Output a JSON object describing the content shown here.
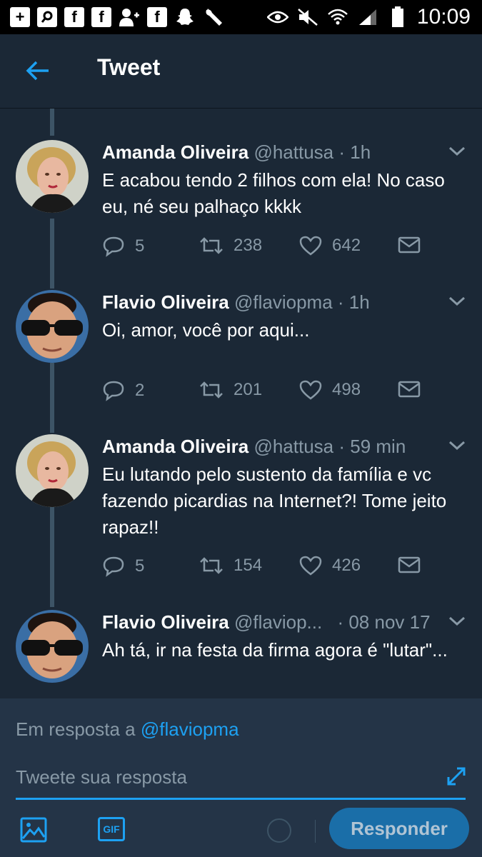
{
  "status_bar": {
    "time": "10:09",
    "left_icons": [
      "add-box-icon",
      "search-box-icon",
      "facebook-icon",
      "facebook-icon",
      "add-friend-icon",
      "facebook-icon",
      "snapchat-icon",
      "wrench-icon"
    ],
    "right_icons": [
      "eye-icon",
      "mute-icon",
      "wifi-icon",
      "signal-icon",
      "battery-icon"
    ]
  },
  "app_bar": {
    "title": "Tweet"
  },
  "tweets": [
    {
      "name": "Amanda Oliveira",
      "handle": "@hattusa",
      "time": "· 1h",
      "text": "E acabou tendo 2 filhos com ela! No caso eu, né seu palhaço kkkk",
      "replies": "5",
      "retweets": "238",
      "likes": "642"
    },
    {
      "name": "Flavio Oliveira",
      "handle": "@flaviopma",
      "time": "· 1h",
      "text": "Oi, amor, você por aqui...",
      "replies": "2",
      "retweets": "201",
      "likes": "498"
    },
    {
      "name": "Amanda Oliveira",
      "handle": "@hattusa",
      "time": "· 59 min",
      "text": "Eu lutando pelo sustento da família e vc fazendo picardias na Internet?! Tome jeito rapaz!!",
      "replies": "5",
      "retweets": "154",
      "likes": "426"
    },
    {
      "name": "Flavio Oliveira",
      "handle": "@flaviop...",
      "time": "· 08 nov 17",
      "text": "Ah tá, ir na festa da firma agora é \"lutar\"..."
    }
  ],
  "composer": {
    "reply_prefix": "Em resposta a",
    "reply_mention": "@flaviopma",
    "placeholder": "Tweete sua resposta",
    "gif_label": "GIF",
    "reply_button": "Responder"
  },
  "colors": {
    "background": "#1b2836",
    "composer_bg": "#243447",
    "accent": "#1da1f2",
    "muted": "#8899a6",
    "thread_line": "#3d5466"
  }
}
